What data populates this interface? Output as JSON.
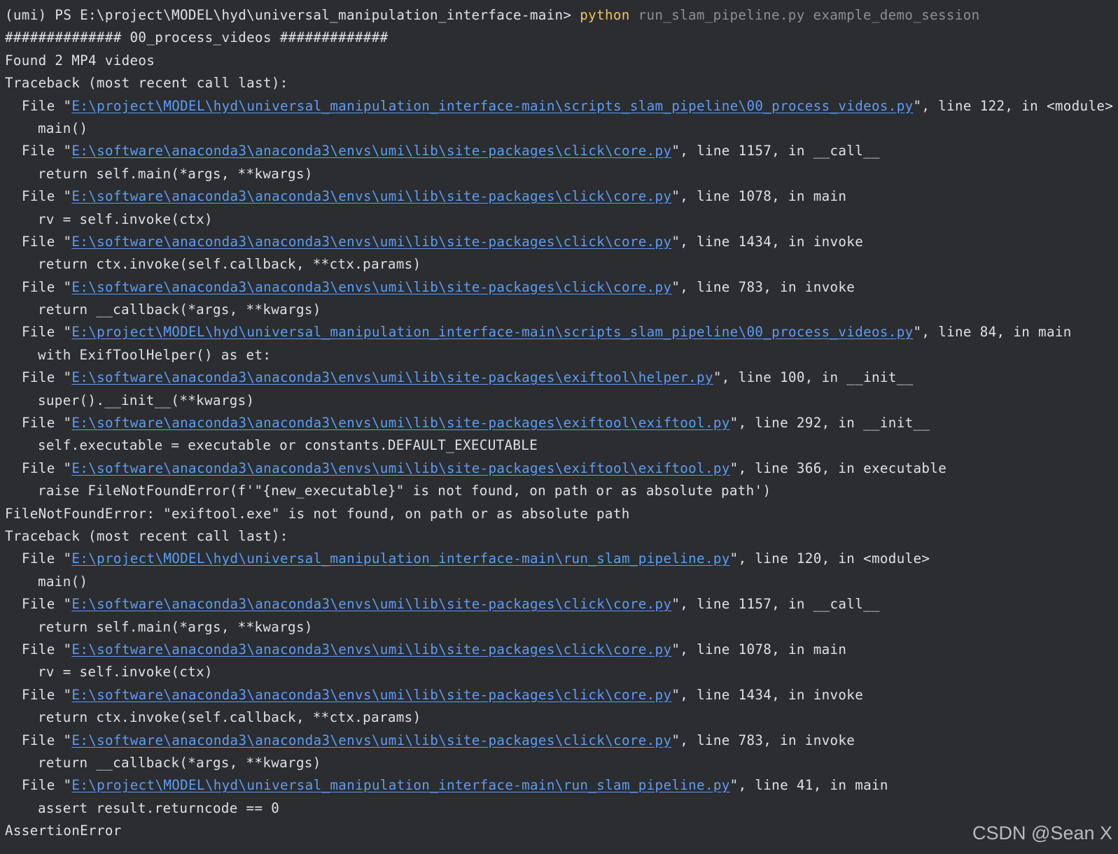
{
  "colors": {
    "background": "#2b2d30",
    "text": "#dfe1e5",
    "command": "#f2c55c",
    "argument": "#8c8f94",
    "link": "#5e9cf5"
  },
  "prompt": {
    "prefix": "(umi) PS E:\\project\\MODEL\\hyd\\universal_manipulation_interface-main> ",
    "command": "python",
    "args": " run_slam_pipeline.py example_demo_session"
  },
  "log": {
    "section_header": "############## 00_process_videos #############",
    "found_videos": "Found 2 MP4 videos",
    "error1": "FileNotFoundError: \"exiftool.exe\" is not found, on path or as absolute path",
    "error2": "AssertionError"
  },
  "tracebacks": [
    {
      "header": "Traceback (most recent call last):",
      "frames": [
        {
          "path": "E:\\project\\MODEL\\hyd\\universal_manipulation_interface-main\\scripts_slam_pipeline\\00_process_videos.py",
          "location": "\", line 122, in <module>",
          "code": "main()"
        },
        {
          "path": "E:\\software\\anaconda3\\anaconda3\\envs\\umi\\lib\\site-packages\\click\\core.py",
          "location": "\", line 1157, in __call__",
          "code": "return self.main(*args, **kwargs)"
        },
        {
          "path": "E:\\software\\anaconda3\\anaconda3\\envs\\umi\\lib\\site-packages\\click\\core.py",
          "location": "\", line 1078, in main",
          "code": "rv = self.invoke(ctx)"
        },
        {
          "path": "E:\\software\\anaconda3\\anaconda3\\envs\\umi\\lib\\site-packages\\click\\core.py",
          "location": "\", line 1434, in invoke",
          "code": "return ctx.invoke(self.callback, **ctx.params)"
        },
        {
          "path": "E:\\software\\anaconda3\\anaconda3\\envs\\umi\\lib\\site-packages\\click\\core.py",
          "location": "\", line 783, in invoke",
          "code": "return __callback(*args, **kwargs)"
        },
        {
          "path": "E:\\project\\MODEL\\hyd\\universal_manipulation_interface-main\\scripts_slam_pipeline\\00_process_videos.py",
          "location": "\", line 84, in main",
          "code": "with ExifToolHelper() as et:"
        },
        {
          "path": "E:\\software\\anaconda3\\anaconda3\\envs\\umi\\lib\\site-packages\\exiftool\\helper.py",
          "location": "\", line 100, in __init__",
          "code": "super().__init__(**kwargs)"
        },
        {
          "path": "E:\\software\\anaconda3\\anaconda3\\envs\\umi\\lib\\site-packages\\exiftool\\exiftool.py",
          "location": "\", line 292, in __init__",
          "code": "self.executable = executable or constants.DEFAULT_EXECUTABLE"
        },
        {
          "path": "E:\\software\\anaconda3\\anaconda3\\envs\\umi\\lib\\site-packages\\exiftool\\exiftool.py",
          "location": "\", line 366, in executable",
          "code": "raise FileNotFoundError(f'\"{new_executable}\" is not found, on path or as absolute path')"
        }
      ]
    },
    {
      "header": "Traceback (most recent call last):",
      "frames": [
        {
          "path": "E:\\project\\MODEL\\hyd\\universal_manipulation_interface-main\\run_slam_pipeline.py",
          "location": "\", line 120, in <module>",
          "code": "main()"
        },
        {
          "path": "E:\\software\\anaconda3\\anaconda3\\envs\\umi\\lib\\site-packages\\click\\core.py",
          "location": "\", line 1157, in __call__",
          "code": "return self.main(*args, **kwargs)"
        },
        {
          "path": "E:\\software\\anaconda3\\anaconda3\\envs\\umi\\lib\\site-packages\\click\\core.py",
          "location": "\", line 1078, in main",
          "code": "rv = self.invoke(ctx)"
        },
        {
          "path": "E:\\software\\anaconda3\\anaconda3\\envs\\umi\\lib\\site-packages\\click\\core.py",
          "location": "\", line 1434, in invoke",
          "code": "return ctx.invoke(self.callback, **ctx.params)"
        },
        {
          "path": "E:\\software\\anaconda3\\anaconda3\\envs\\umi\\lib\\site-packages\\click\\core.py",
          "location": "\", line 783, in invoke",
          "code": "return __callback(*args, **kwargs)"
        },
        {
          "path": "E:\\project\\MODEL\\hyd\\universal_manipulation_interface-main\\run_slam_pipeline.py",
          "location": "\", line 41, in main",
          "code": "assert result.returncode == 0"
        }
      ]
    }
  ],
  "file_prefix": "File \"",
  "watermark": "CSDN @Sean X"
}
